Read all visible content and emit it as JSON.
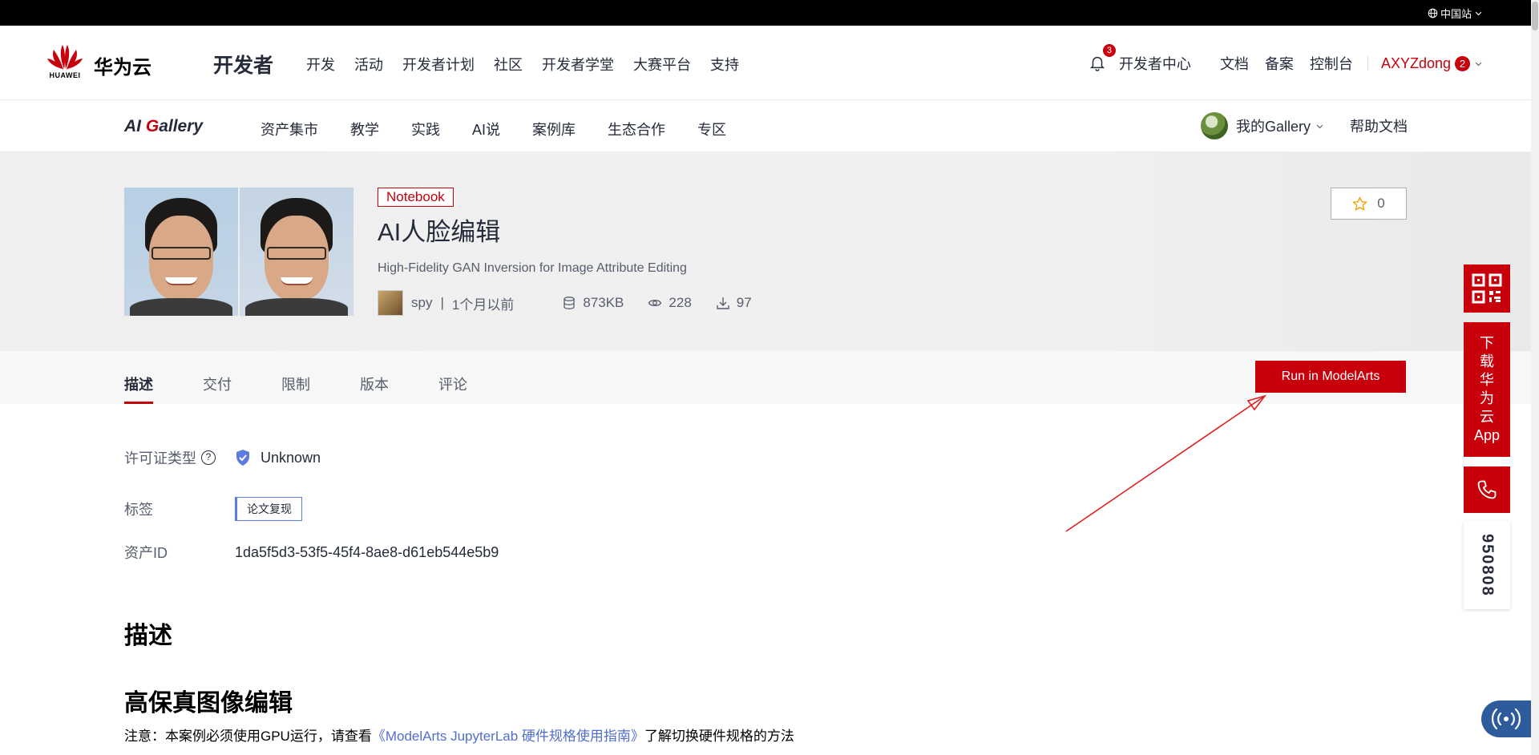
{
  "topbar": {
    "site": "中国站"
  },
  "header": {
    "logo_word": "HUAWEI",
    "logo_text": "华为云",
    "section_title": "开发者",
    "nav": [
      "开发",
      "活动",
      "开发者计划",
      "社区",
      "开发者学堂",
      "大赛平台",
      "支持"
    ],
    "notifications": "3",
    "dev_center": "开发者中心",
    "links": [
      "文档",
      "备案",
      "控制台"
    ],
    "username": "AXYZdong",
    "user_badge": "2"
  },
  "subnav": {
    "logo_ai": "AI ",
    "logo_g": "G",
    "logo_rest": "allery",
    "items": [
      "资产集市",
      "教学",
      "实践",
      "AI说",
      "案例库",
      "生态合作",
      "专区"
    ],
    "my_gallery": "我的Gallery",
    "help": "帮助文档"
  },
  "asset": {
    "type_badge": "Notebook",
    "title": "AI人脸编辑",
    "subtitle": "High-Fidelity GAN Inversion for Image Attribute Editing",
    "author": "spy",
    "time": "1个月以前",
    "size": "873KB",
    "views": "228",
    "downloads": "97",
    "stars": "0"
  },
  "tabs": [
    "描述",
    "交付",
    "限制",
    "版本",
    "评论"
  ],
  "run_button": "Run in ModelArts",
  "details": {
    "license_label": "许可证类型",
    "license_value": "Unknown",
    "tags_label": "标签",
    "tag": "论文复现",
    "id_label": "资产ID",
    "id_value": "1da5f5d3-53f5-45f4-8ae8-d61eb544e5b9"
  },
  "content": {
    "heading": "描述",
    "section": "高保真图像编辑",
    "note_prefix": "注意：本案例必须使用GPU运行，请查看",
    "note_link": "《ModelArts JupyterLab 硬件规格使用指南》",
    "note_suffix": "了解切换硬件规格的方法"
  },
  "float": {
    "download_chars": [
      "下",
      "载",
      "华",
      "为",
      "云",
      "App"
    ],
    "phone": "950808"
  },
  "colors": {
    "brand": "#c7000b",
    "link": "#526ecc",
    "text": "#252b3a",
    "muted": "#575d6c"
  }
}
